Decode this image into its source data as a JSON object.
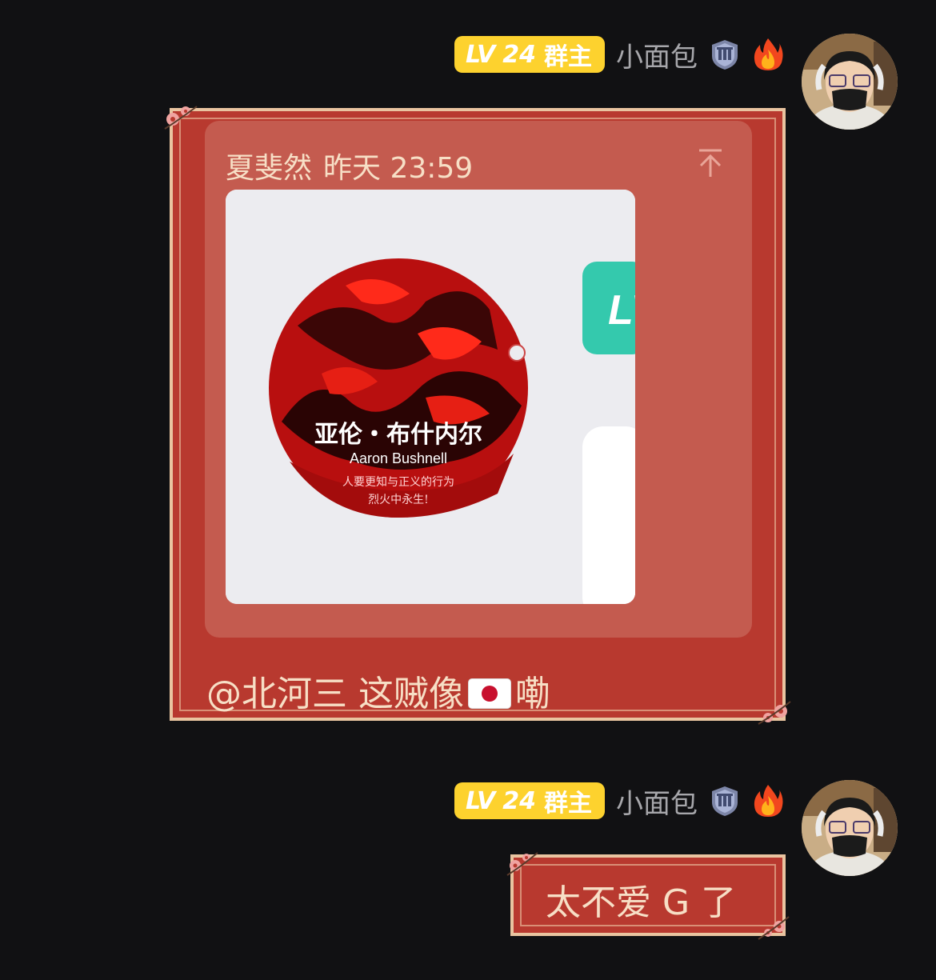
{
  "messages": [
    {
      "sender": {
        "level_prefix": "LV",
        "level_num": "24",
        "role": "群主",
        "name": "小面包"
      },
      "quote": {
        "author": "夏斐然",
        "time": "昨天 23:59",
        "image_title_cn": "亚伦・布什内尔",
        "image_title_en": "Aaron Bushnell",
        "image_caption_1": "人要更知与正义的行为",
        "image_caption_2": "烈火中永生!",
        "image_side_badge": "LV"
      },
      "text_before_flag": "@北河三 这贼像",
      "flag_icon": "japan-flag-icon",
      "text_after_flag": "嘞"
    },
    {
      "sender": {
        "level_prefix": "LV",
        "level_num": "24",
        "role": "群主",
        "name": "小面包"
      },
      "text": "太不爱 G 了"
    }
  ],
  "colors": {
    "background": "#111113",
    "bubble": "#b8392f",
    "bubble_border": "#e9c4a0",
    "quote_card": "#c45b4f",
    "level_badge": "#fdd22e",
    "text_warm": "#f7dfc6"
  }
}
